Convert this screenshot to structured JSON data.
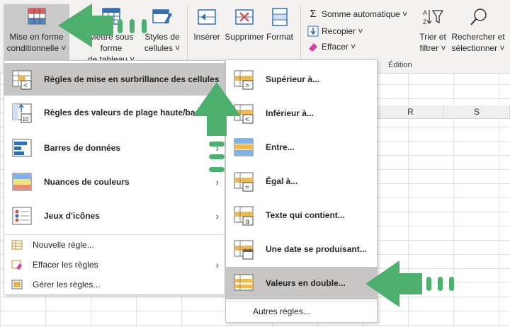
{
  "ribbon": {
    "mise_en_forme": "Mise en forme conditionnelle ˅",
    "mise_en_forme_l1": "Mise en forme",
    "mise_en_forme_l2": "conditionnelle ˅",
    "mettre_tableau_l1": "Mettre sous forme",
    "mettre_tableau_l2": "de tableau ˅",
    "styles_l1": "Styles de",
    "styles_l2": "cellules ˅",
    "inserer": "Insérer",
    "supprimer": "Supprimer",
    "format": "Format",
    "somme": "Somme automatique ˅",
    "recopier": "Recopier ˅",
    "effacer": "Effacer ˅",
    "trier_l1": "Trier et",
    "trier_l2": "filtrer ˅",
    "rechercher_l1": "Rechercher et",
    "rechercher_l2": "sélectionner ˅",
    "group_edition": "Édition"
  },
  "grid": {
    "col_r": "R",
    "col_s": "S"
  },
  "menu_main": {
    "items": [
      {
        "label": "Règles de mise en surbrillance des cellules",
        "icon": "highlight-rules-icon",
        "has_submenu": true,
        "highlighted": true
      },
      {
        "label": "Règles des valeurs de plage haute/basse",
        "icon": "top-bottom-rules-icon",
        "has_submenu": true,
        "highlighted": false
      },
      {
        "label": "Barres de données",
        "icon": "data-bars-icon",
        "has_submenu": true,
        "highlighted": false
      },
      {
        "label": "Nuances de couleurs",
        "icon": "color-scales-icon",
        "has_submenu": true,
        "highlighted": false
      },
      {
        "label": "Jeux d'icônes",
        "icon": "icon-sets-icon",
        "has_submenu": true,
        "highlighted": false
      }
    ],
    "small_items": [
      {
        "label": "Nouvelle règle...",
        "icon": "new-rule-icon"
      },
      {
        "label": "Effacer les règles",
        "icon": "clear-rules-icon",
        "has_submenu": true
      },
      {
        "label": "Gérer les règles...",
        "icon": "manage-rules-icon"
      }
    ]
  },
  "menu_sub": {
    "items": [
      {
        "label": "Supérieur à...",
        "icon": "greater-than-icon"
      },
      {
        "label": "Inférieur à...",
        "icon": "less-than-icon"
      },
      {
        "label": "Entre...",
        "icon": "between-icon"
      },
      {
        "label": "Égal à...",
        "icon": "equal-to-icon"
      },
      {
        "label": "Texte qui contient...",
        "icon": "text-contains-icon"
      },
      {
        "label": "Une date se produisant...",
        "icon": "date-occurring-icon"
      },
      {
        "label": "Valeurs en double...",
        "icon": "duplicate-values-icon",
        "highlighted": true
      }
    ],
    "footer": "Autres règles..."
  },
  "colors": {
    "arrow_green": "#4caf6e",
    "menu_highlight": "#c8c6c4",
    "ribbon_bg": "#f3f2f1",
    "icon_blue": "#2f6fb8",
    "icon_red": "#d9534f",
    "icon_orange": "#f2b84b"
  }
}
